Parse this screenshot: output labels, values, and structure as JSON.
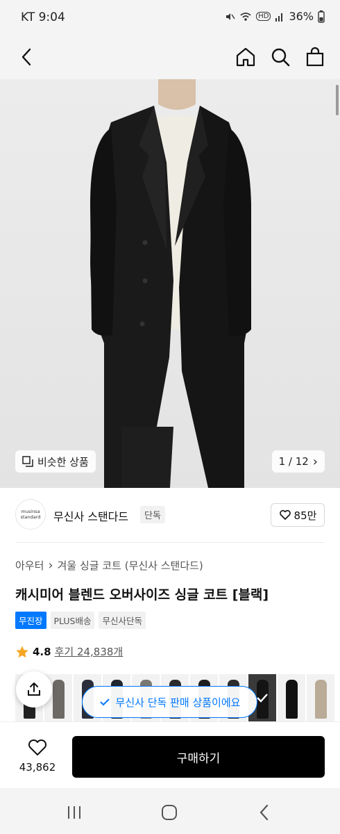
{
  "status_bar": {
    "carrier_time": "KT 9:04",
    "icons": [
      "mute-icon",
      "wifi-icon",
      "hd-icon",
      "signal-icon",
      "battery-icon"
    ],
    "hd_label": "HD",
    "battery": "36%"
  },
  "nav": {
    "icons": [
      "back-arrow-icon",
      "home-icon",
      "search-icon",
      "shopping-bag-icon"
    ]
  },
  "hero": {
    "similar_label": "비슷한 상품",
    "counter": "1 / 12",
    "chevron": "›"
  },
  "brand": {
    "logo_line1": "musinsa",
    "logo_line2": "standard",
    "name": "무신사 스탠다드",
    "exclusive_tag": "단독",
    "likes": "85만"
  },
  "product": {
    "breadcrumb": [
      "아우터",
      "겨울 싱글 코트 (무신사 스탠다드)"
    ],
    "breadcrumb_sep": "›",
    "title": "캐시미어 블렌드 오버사이즈 싱글 코트 [블랙]",
    "tags": [
      "무진장",
      "PLUS배송",
      "무신사단독"
    ],
    "rating": "4.8",
    "review_text": "후기 24,838개"
  },
  "toast": {
    "text": "무신사 단독 판매 상품이에요"
  },
  "action_bar": {
    "wish_count": "43,862",
    "buy_label": "구매하기"
  },
  "colors": {
    "accent_blue": "#0078ff",
    "buy_button": "#000000",
    "star": "#f5a623"
  }
}
